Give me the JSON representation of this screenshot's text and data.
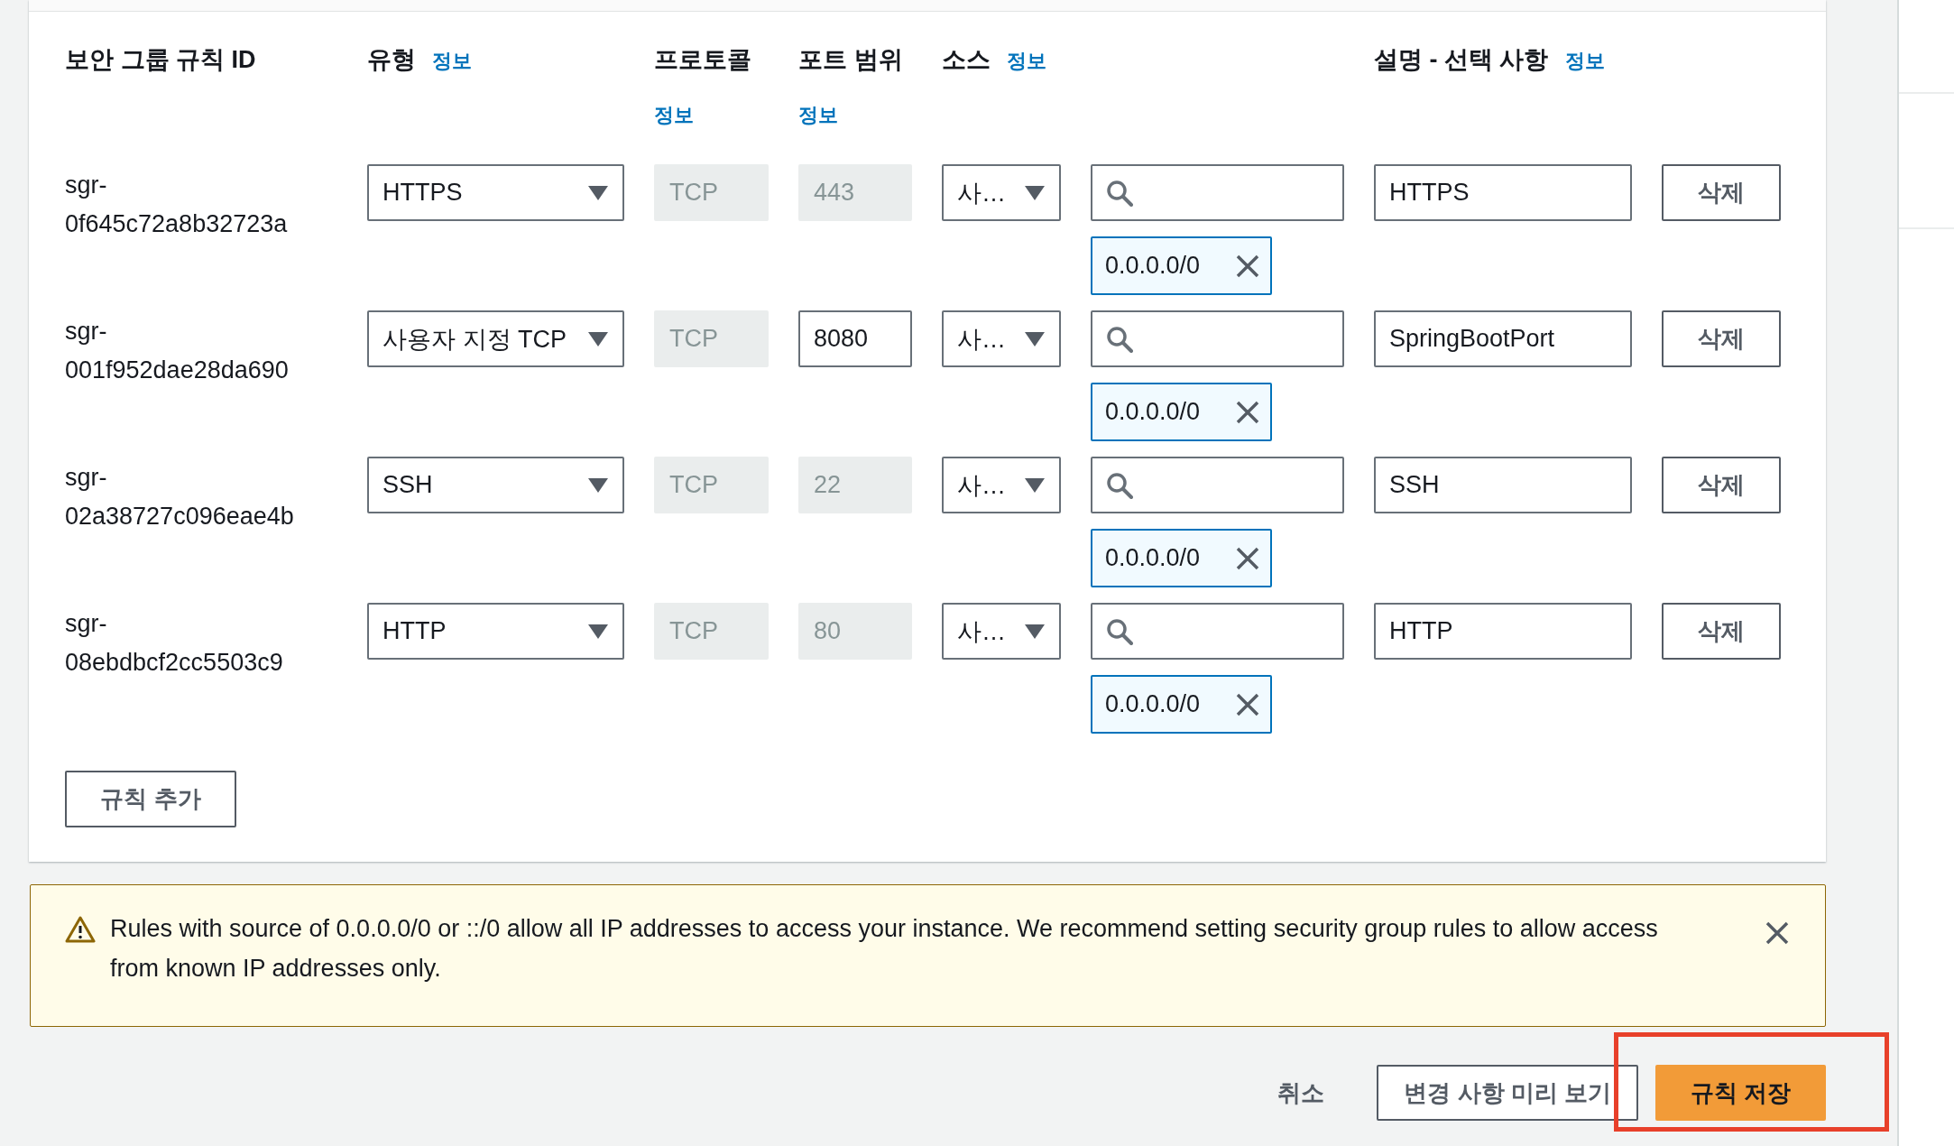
{
  "table": {
    "columns": [
      {
        "label": "보안 그룹 규칙 ID"
      },
      {
        "label": "유형",
        "info": "정보"
      },
      {
        "label": "프로토콜",
        "info": "정보"
      },
      {
        "label": "포트 범위",
        "info": "정보"
      },
      {
        "label": "소스",
        "info": "정보"
      },
      {
        "label": "설명 - 선택 사항",
        "info": "정보"
      }
    ],
    "rules": [
      {
        "id": "sgr-0f645c72a8b32723a",
        "type": "HTTPS",
        "protocol": "TCP",
        "port": "443",
        "port_disabled": true,
        "source": "사…",
        "cidr": "0.0.0.0/0",
        "description": "HTTPS",
        "delete": "삭제"
      },
      {
        "id": "sgr-001f952dae28da690",
        "type": "사용자 지정 TCP",
        "protocol": "TCP",
        "port": "8080",
        "port_disabled": false,
        "source": "사…",
        "cidr": "0.0.0.0/0",
        "description": "SpringBootPort",
        "delete": "삭제"
      },
      {
        "id": "sgr-02a38727c096eae4b",
        "type": "SSH",
        "protocol": "TCP",
        "port": "22",
        "port_disabled": true,
        "source": "사…",
        "cidr": "0.0.0.0/0",
        "description": "SSH",
        "delete": "삭제"
      },
      {
        "id": "sgr-08ebdbcf2cc5503c9",
        "type": "HTTP",
        "protocol": "TCP",
        "port": "80",
        "port_disabled": true,
        "source": "사…",
        "cidr": "0.0.0.0/0",
        "description": "HTTP",
        "delete": "삭제"
      }
    ],
    "add_rule": "규칙 추가"
  },
  "alert": {
    "message": "Rules with source of 0.0.0.0/0 or ::/0 allow all IP addresses to access your instance. We recommend setting security group rules to allow access from known IP addresses only."
  },
  "footer": {
    "cancel": "취소",
    "preview": "변경 사항 미리 보기",
    "save": {
      "label": "규칙 저장",
      "highlighted": true
    }
  }
}
